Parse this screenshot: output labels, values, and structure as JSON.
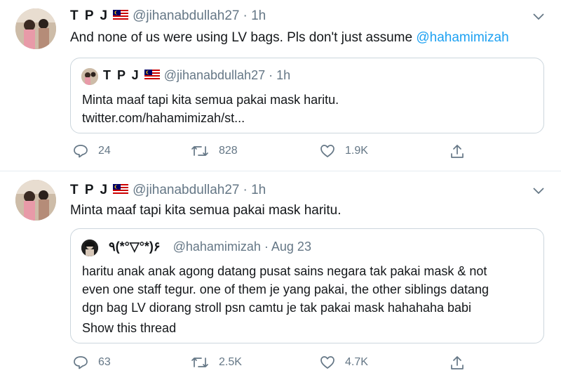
{
  "tweets": [
    {
      "name": "T P J",
      "handle": "@jihanabdullah27",
      "time": "· 1h",
      "text_before": "And none of us were using LV bags. Pls don't just assume ",
      "mention": "@hahamimizah",
      "quote": {
        "name": "T P J",
        "handle": "@jihanabdullah27 · 1h",
        "lines": [
          "Minta maaf tapi kita semua pakai mask haritu.",
          "twitter.com/hahamimizah/st..."
        ]
      },
      "actions": {
        "replies": "24",
        "retweets": "828",
        "likes": "1.9K"
      }
    },
    {
      "name": "T P J",
      "handle": "@jihanabdullah27",
      "time": "· 1h",
      "text": "Minta maaf tapi kita semua pakai mask haritu.",
      "quote": {
        "name": "٩(*°▽°*)۶",
        "handle": "@hahamimizah · Aug 23",
        "lines": [
          "haritu anak anak agong datang pusat sains negara tak pakai mask & not",
          "even one staff tegur. one of them je yang pakai, the other siblings datang",
          "dgn bag LV diorang stroll psn camtu je tak pakai mask hahahaha babi"
        ],
        "show_thread": "Show this thread"
      },
      "actions": {
        "replies": "63",
        "retweets": "2.5K",
        "likes": "4.7K"
      }
    }
  ],
  "icons": {
    "reply": "reply-icon",
    "retweet": "retweet-icon",
    "like": "like-icon",
    "share": "share-icon",
    "caret": "chevron-down-icon",
    "flag": "malaysia-flag-icon"
  }
}
